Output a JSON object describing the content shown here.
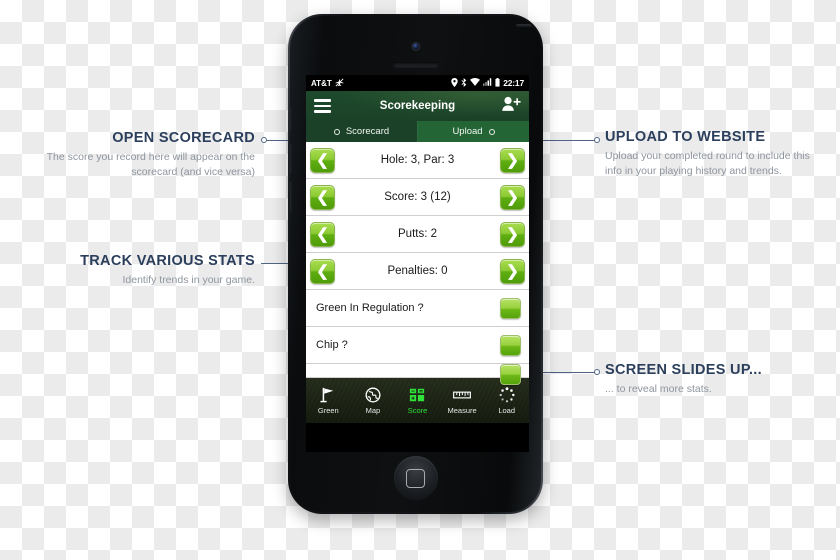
{
  "annotations": {
    "open_scorecard": {
      "title": "OPEN SCORECARD",
      "body": "The score you record here will appear on the scorecard (and vice versa)"
    },
    "track_stats": {
      "title": "TRACK VARIOUS STATS",
      "body": "Identify trends in your game."
    },
    "upload_website": {
      "title": "UPLOAD TO WEBSITE",
      "body": "Upload your completed round to include this info in your playing history and trends."
    },
    "screen_slides": {
      "title": "SCREEN SLIDES UP...",
      "body": "... to reveal more stats."
    }
  },
  "phone": {
    "status_bar": {
      "carrier": "AT&T",
      "carrier_icon": "airplane-crossed-icon",
      "icons": [
        "location-pin-icon",
        "bluetooth-icon",
        "wifi-icon",
        "signal-bars-icon",
        "battery-icon"
      ],
      "clock": "22:17"
    },
    "header": {
      "menu_icon": "hamburger-menu-icon",
      "title": "Scorekeeping",
      "action_icon": "add-person-icon"
    },
    "tabs": [
      {
        "label": "Scorecard",
        "radio_side": "left",
        "active": false
      },
      {
        "label": "Upload",
        "radio_side": "right",
        "active": true
      }
    ],
    "rows": [
      {
        "type": "stepper",
        "label": "Hole: 3, Par: 3",
        "prev_icon": "chevron-left-icon",
        "next_icon": "chevron-right-icon"
      },
      {
        "type": "stepper",
        "label": "Score: 3 (12)",
        "prev_icon": "chevron-left-icon",
        "next_icon": "chevron-right-icon"
      },
      {
        "type": "stepper",
        "label": "Putts: 2",
        "prev_icon": "chevron-left-icon",
        "next_icon": "chevron-right-icon"
      },
      {
        "type": "stepper",
        "label": "Penalties: 0",
        "prev_icon": "chevron-left-icon",
        "next_icon": "chevron-right-icon"
      },
      {
        "type": "toggle",
        "label": "Green In Regulation ?",
        "checked": true
      },
      {
        "type": "toggle",
        "label": "Chip ?",
        "checked": true
      },
      {
        "type": "toggle",
        "label": "",
        "checked": true
      }
    ],
    "bottom_nav": [
      {
        "label": "Green",
        "icon": "flag-icon",
        "active": false
      },
      {
        "label": "Map",
        "icon": "globe-icon",
        "active": false
      },
      {
        "label": "Score",
        "icon": "calculator-icon",
        "active": true
      },
      {
        "label": "Measure",
        "icon": "ruler-icon",
        "active": false
      },
      {
        "label": "Load",
        "icon": "spinner-icon",
        "active": false
      }
    ],
    "home_button_icon": "home-square-icon"
  },
  "colors": {
    "header_green": "#1b4228",
    "tab_active_green": "#246536",
    "button_green": "#8ccb35",
    "accent_nav_green": "#2ee23a",
    "annotation_title": "#2b3f5c",
    "annotation_body": "#8e959e",
    "connector": "#4f6484"
  }
}
